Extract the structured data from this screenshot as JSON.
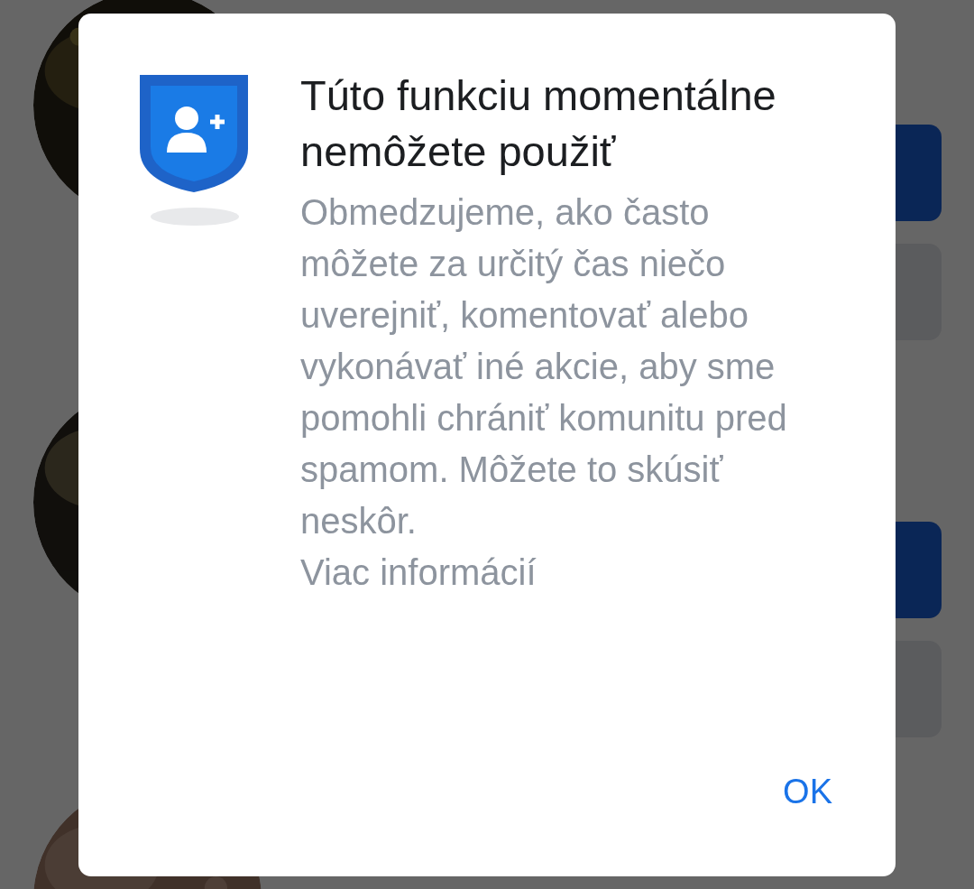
{
  "people": [
    {
      "photo": {
        "kind": "picture"
      },
      "actions": [
        {
          "kind": "primary"
        },
        {
          "kind": "secondary"
        }
      ]
    },
    {
      "photo": {
        "kind": "picture"
      },
      "actions": [
        {
          "kind": "primary"
        },
        {
          "kind": "secondary"
        }
      ]
    },
    {
      "photo": {
        "kind": "picture"
      }
    }
  ],
  "dialog": {
    "title": "Túto funkciu momentálne nemôžete použiť",
    "message": "Obmedzujeme, ako často môžete za určitý čas niečo uverejniť, komentovať alebo vykonávať iné akcie, aby sme pomohli chrániť komunitu pred spamom. Môžete to skúsiť neskôr.",
    "link": "Viac informácií",
    "button": "OK"
  }
}
